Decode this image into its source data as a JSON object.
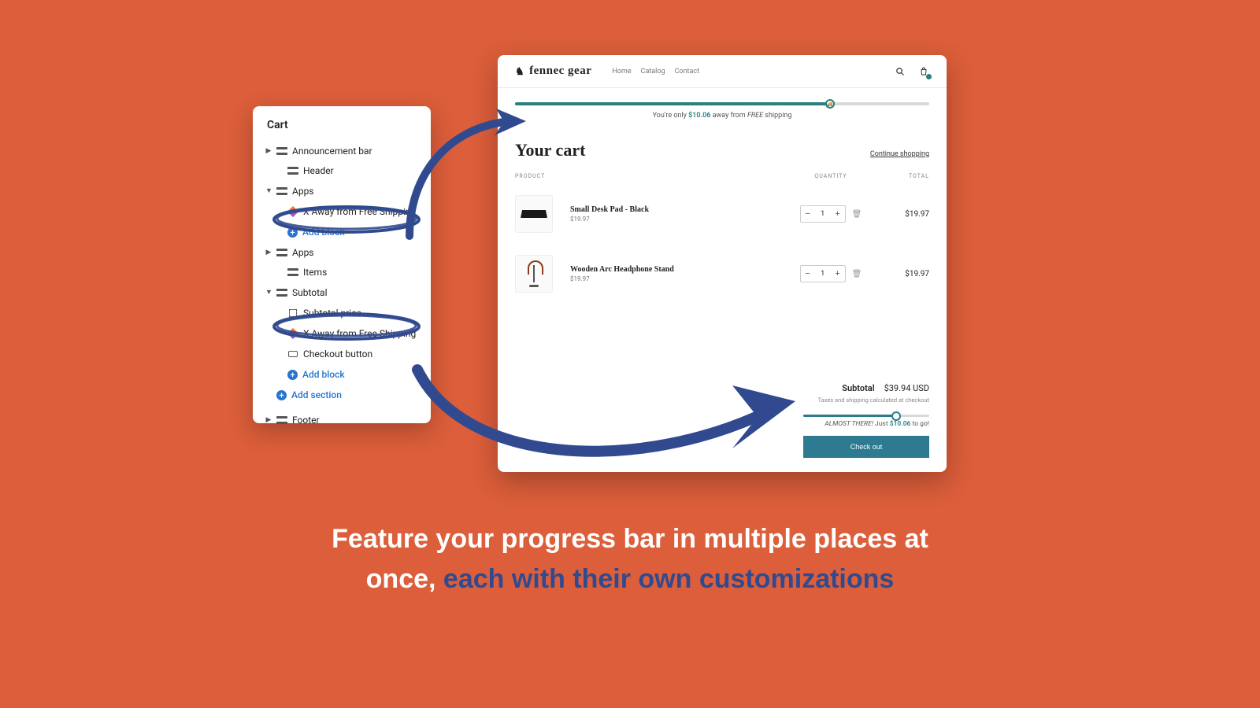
{
  "editor": {
    "title": "Cart",
    "items": {
      "announcement": "Announcement bar",
      "header": "Header",
      "apps_a": "Apps",
      "xaway_a": "X Away from Free Shipping",
      "add_block_a": "Add block",
      "apps_b": "Apps",
      "items": "Items",
      "subtotal": "Subtotal",
      "subtotal_price": "Subtotal price",
      "xaway_b": "X Away from Free Shipping",
      "checkout_btn": "Checkout button",
      "add_block_b": "Add block",
      "add_section": "Add section",
      "footer": "Footer"
    }
  },
  "store": {
    "brand": "fennec gear",
    "nav": {
      "home": "Home",
      "catalog": "Catalog",
      "contact": "Contact"
    },
    "progress_top": {
      "percent": 76,
      "fill_color": "#2a7e7e",
      "text_before": "You're only ",
      "amount": "$10.06",
      "text_mid": " away from ",
      "emph": "FREE",
      "text_after": " shipping"
    },
    "cart_title": "Your cart",
    "continue": "Continue shopping",
    "columns": {
      "product": "PRODUCT",
      "quantity": "QUANTITY",
      "total": "TOTAL"
    },
    "lines": [
      {
        "name": "Small Desk Pad - Black",
        "price": "$19.97",
        "qty": "1",
        "total": "$19.97"
      },
      {
        "name": "Wooden Arc Headphone Stand",
        "price": "$19.97",
        "qty": "1",
        "total": "$19.97"
      }
    ],
    "subtotal_label": "Subtotal",
    "subtotal_value": "$39.94 USD",
    "tax_note": "Taxes and shipping calculated at checkout",
    "progress_bottom": {
      "percent": 74,
      "fill_color": "#2d7a91",
      "prefix": "ALMOST THERE!",
      "mid": " Just ",
      "amount": "$10.06",
      "suffix": " to go!"
    },
    "checkout": "Check out"
  },
  "caption": {
    "line1": "Feature your progress bar in multiple places at",
    "line2a": "once",
    "line2b": ", ",
    "line2c": "each with their own customizations"
  }
}
